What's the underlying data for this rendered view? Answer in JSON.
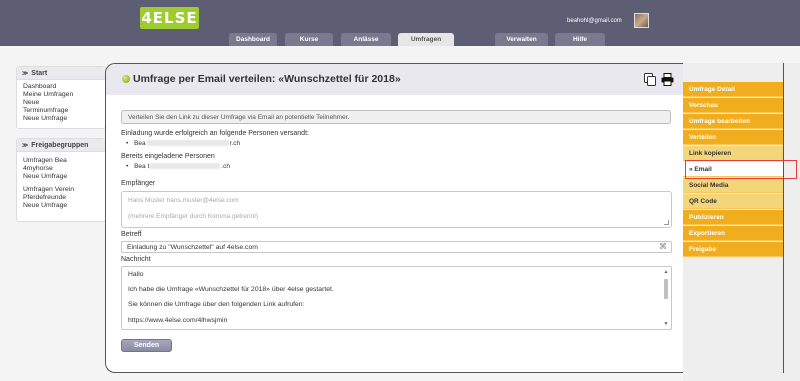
{
  "header": {
    "logo_text": "4ELSE",
    "user_email": "beahohl@gmail.com",
    "tabs": [
      {
        "label": "Dashboard"
      },
      {
        "label": "Kurse"
      },
      {
        "label": "Anlässe"
      },
      {
        "label": "Umfragen"
      },
      {
        "label": "Verwalten"
      },
      {
        "label": "Hilfe"
      }
    ],
    "active_tab": "Umfragen"
  },
  "sidebar": {
    "start": {
      "title": "Start",
      "items": [
        "Dashboard",
        "Meine Umfragen",
        "Neue",
        "Terminumfrage",
        "Neue Umfrage"
      ]
    },
    "freigabegruppen": {
      "title": "Freigabegruppen",
      "groups": [
        [
          "Umfragen Bea",
          "4myhorse",
          "Neue Umfrage"
        ],
        [
          "Umfragen Verein",
          "Pferdefreunde",
          "Neue Umfrage"
        ]
      ]
    }
  },
  "main": {
    "title": "Umfrage per Email verteilen: «Wunschzettel für 2018»",
    "info": "Verteilen Sie den Link zu dieser Umfrage via Email an potentielle Teilnehmer.",
    "sent_label": "Einladung wurde erfolgreich an folgende Personen versandt:",
    "sent_recipient_prefix": "Bea",
    "sent_recipient_suffix": "r.ch",
    "already_label": "Bereits eingeladene Personen",
    "already_recipient_prefix": "Bea t",
    "already_recipient_suffix": ".ch",
    "recipients_label": "Empfänger",
    "recipients_placeholder_1": "Hans Muster hans.muster@4else.com",
    "recipients_placeholder_2": "(mehrere Empfänger durch Komma getrennt)",
    "subject_label": "Betreff",
    "subject_value": "Einladung zu \"Wunschzettel\" auf 4else.com",
    "message_label": "Nachricht",
    "message_lines": [
      "Hallo",
      "Ich habe die Umfrage «Wunschzettel für 2018» über 4else gestartet.",
      "Sie können die Umfrage über den folgenden Link aufrufen:",
      "https://www.4else.com/4lhwsjmin"
    ],
    "send_label": "Senden"
  },
  "right_menu": {
    "items": [
      {
        "label": "Umfrage Detail",
        "kind": "main"
      },
      {
        "label": "Vorschau",
        "kind": "main"
      },
      {
        "label": "Umfrage bearbeiten",
        "kind": "main"
      },
      {
        "label": "Verteilen",
        "kind": "main"
      },
      {
        "label": "Link kopieren",
        "kind": "sub"
      },
      {
        "label": "» Email",
        "kind": "sub-active"
      },
      {
        "label": "Social Media",
        "kind": "sub"
      },
      {
        "label": "QR Code",
        "kind": "sub"
      },
      {
        "label": "Publizieren",
        "kind": "main"
      },
      {
        "label": "Exportieren",
        "kind": "main"
      },
      {
        "label": "Freigabe",
        "kind": "main"
      }
    ]
  },
  "colors": {
    "header_bg": "#5d5d73",
    "logo_green": "#9ecb2e",
    "menu_orange": "#f0ad1e",
    "menu_sub": "#f3d67a",
    "highlight_red": "#e53c3c"
  }
}
